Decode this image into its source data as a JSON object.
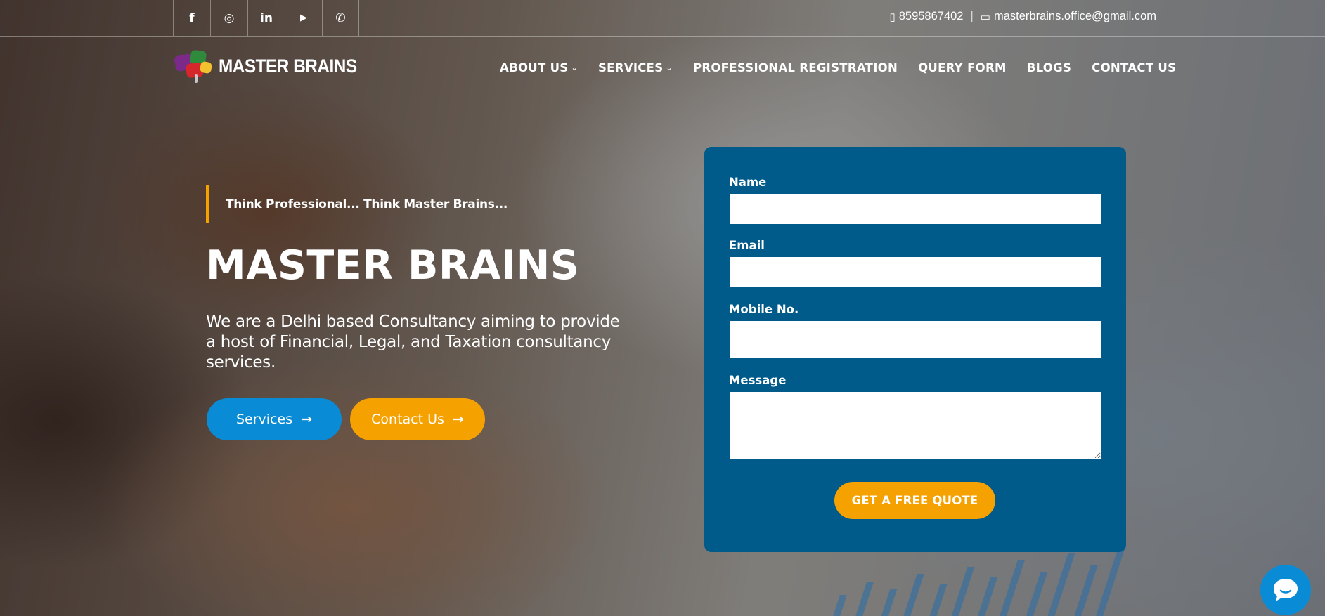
{
  "topbar": {
    "social": [
      {
        "icon": "facebook-icon",
        "glyph": "f"
      },
      {
        "icon": "instagram-icon",
        "glyph": "◎"
      },
      {
        "icon": "linkedin-icon",
        "glyph": "in"
      },
      {
        "icon": "youtube-icon",
        "glyph": "▶"
      },
      {
        "icon": "whatsapp-icon",
        "glyph": "✆"
      }
    ],
    "phone": "8595867402",
    "separator": "|",
    "email": "masterbrains.office@gmail.com"
  },
  "header": {
    "logo_text": "MASTER BRAINS",
    "nav": [
      {
        "label": "ABOUT US",
        "has_dropdown": true
      },
      {
        "label": "SERVICES",
        "has_dropdown": true
      },
      {
        "label": "PROFESSIONAL REGISTRATION",
        "has_dropdown": false
      },
      {
        "label": "QUERY FORM",
        "has_dropdown": false
      },
      {
        "label": "BLOGS",
        "has_dropdown": false
      },
      {
        "label": "CONTACT US",
        "has_dropdown": false
      }
    ]
  },
  "hero": {
    "tagline": "Think Professional... Think Master Brains...",
    "title": "MASTER BRAINS",
    "description": "We are a Delhi based Consultancy aiming to provide a host of Financial, Legal, and Taxation consultancy services.",
    "services_button": "Services",
    "contact_button": "Contact Us"
  },
  "form": {
    "name_label": "Name",
    "name_value": "",
    "email_label": "Email",
    "email_value": "",
    "mobile_label": "Mobile No.",
    "mobile_value": "",
    "message_label": "Message",
    "message_value": "",
    "submit_label": "GET A FREE QUOTE"
  },
  "colors": {
    "accent_orange": "#f5a100",
    "primary_blue": "#0a8bd6",
    "form_bg": "#005a8a"
  }
}
